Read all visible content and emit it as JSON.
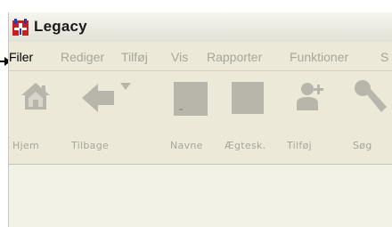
{
  "window": {
    "title": "Legacy"
  },
  "menu": {
    "items": [
      {
        "label": "Filer",
        "active": true
      },
      {
        "label": "Rediger",
        "active": false
      },
      {
        "label": "Tilføj",
        "active": false
      },
      {
        "label": "Vis",
        "active": false
      },
      {
        "label": "Rapporter",
        "active": false
      },
      {
        "label": "Funktioner",
        "active": false
      },
      {
        "label": "S",
        "active": false
      }
    ]
  },
  "toolbar": {
    "buttons": [
      {
        "label": "Hjem",
        "icon": "home-icon"
      },
      {
        "label": "Tilbage",
        "icon": "back-arrow-icon"
      },
      {
        "label": "Navne",
        "icon": "names-icon"
      },
      {
        "label": "Ægtesk.",
        "icon": "marriage-icon"
      },
      {
        "label": "Tilføj",
        "icon": "add-person-icon"
      },
      {
        "label": "Søg",
        "icon": "search-key-icon"
      }
    ]
  },
  "colors": {
    "menu_background": "#ece9d8",
    "disabled_text": "#a8a59a",
    "disabled_icon": "#b8b6ab",
    "content_background": "#f2f1e6"
  }
}
